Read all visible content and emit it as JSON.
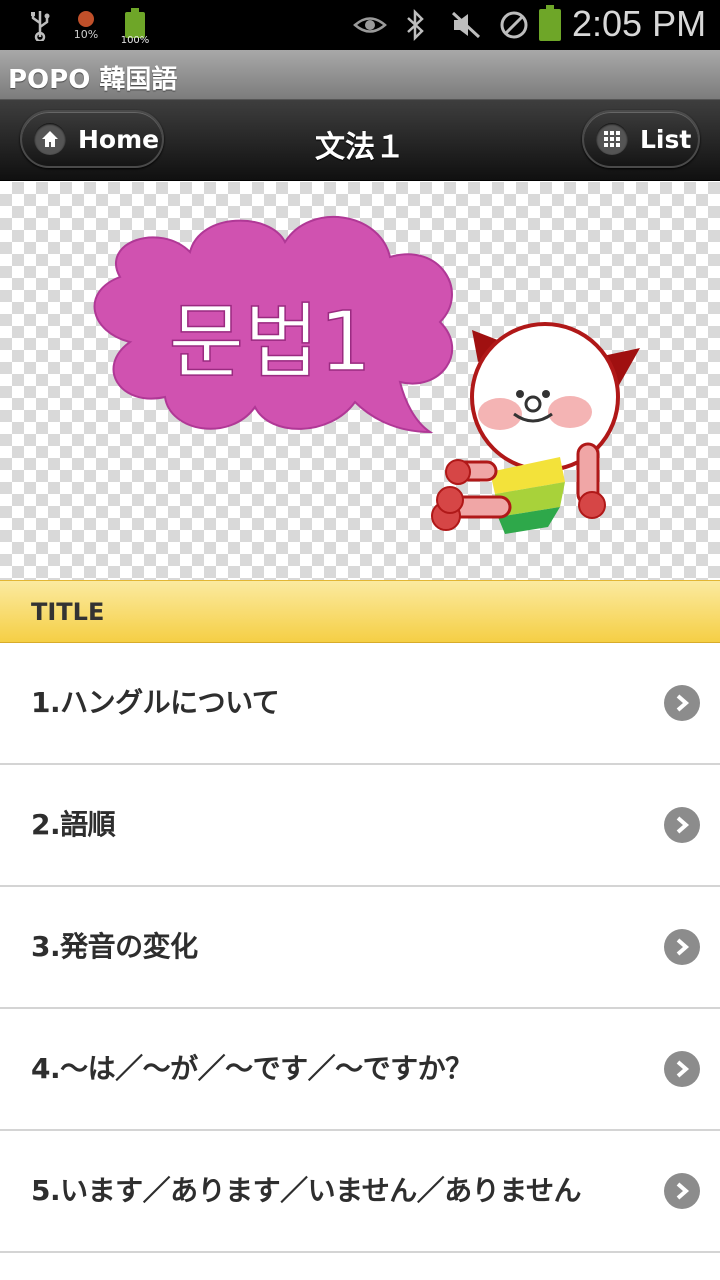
{
  "status_bar": {
    "time": "2:05 PM",
    "weather_pct": "10%",
    "battery_small_pct": "100%",
    "icons": [
      "usb-icon",
      "weather-icon",
      "battery-full-icon",
      "eye-icon",
      "bluetooth-icon",
      "mute-icon",
      "blocked-icon",
      "battery-icon"
    ]
  },
  "app": {
    "title": "POPO 韓国語"
  },
  "header": {
    "title": "文法１",
    "home_label": "Home",
    "list_label": "List"
  },
  "banner": {
    "text": "문법1"
  },
  "list": {
    "divider_label": "TITLE",
    "items": [
      {
        "label": "1.ハングルについて"
      },
      {
        "label": "2.語順"
      },
      {
        "label": "3.発音の変化"
      },
      {
        "label": "4.〜は／〜が／〜です／〜ですか？"
      },
      {
        "label": "5.います／あります／いません／ありません"
      }
    ]
  },
  "colors": {
    "divider": "#f5cf45",
    "cloud": "#d052b0",
    "header": "#1a1a1a"
  }
}
